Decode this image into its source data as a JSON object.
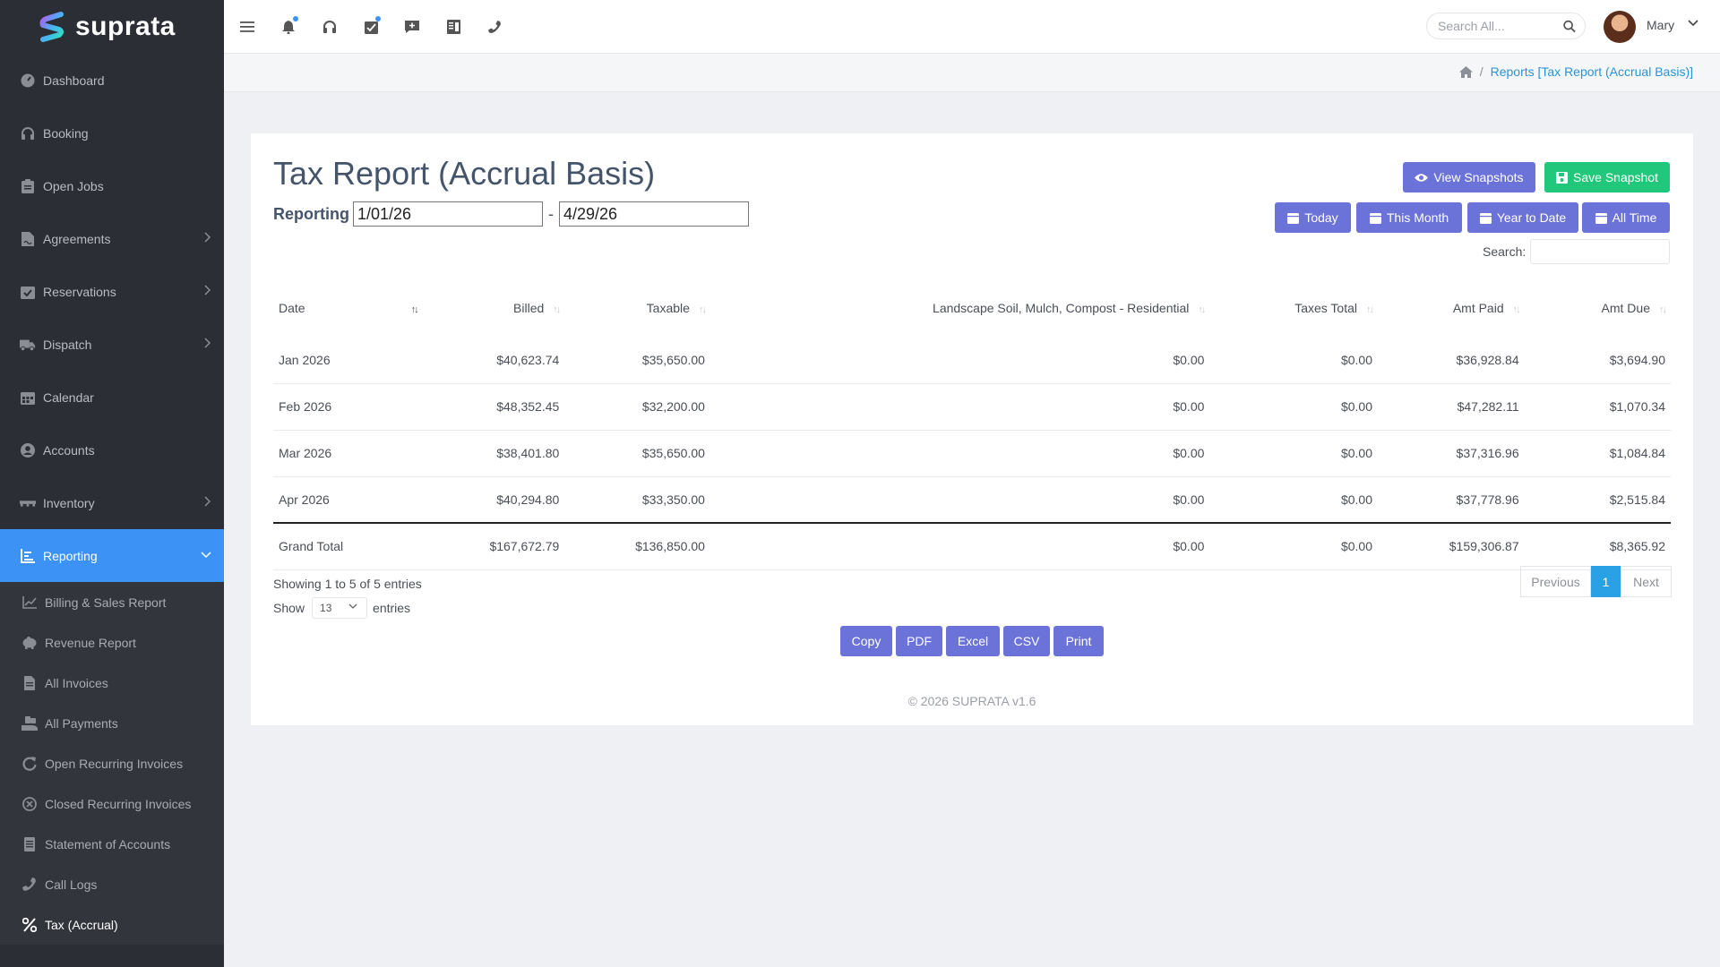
{
  "app": {
    "name": "suprata"
  },
  "sidebar": {
    "items": [
      {
        "label": "Dashboard"
      },
      {
        "label": "Booking"
      },
      {
        "label": "Open Jobs"
      },
      {
        "label": "Agreements"
      },
      {
        "label": "Reservations"
      },
      {
        "label": "Dispatch"
      },
      {
        "label": "Calendar"
      },
      {
        "label": "Accounts"
      },
      {
        "label": "Inventory"
      },
      {
        "label": "Reporting"
      }
    ],
    "reporting_sub": [
      {
        "label": "Billing & Sales Report"
      },
      {
        "label": "Revenue Report"
      },
      {
        "label": "All Invoices"
      },
      {
        "label": "All Payments"
      },
      {
        "label": "Open Recurring Invoices"
      },
      {
        "label": "Closed Recurring Invoices"
      },
      {
        "label": "Statement of Accounts"
      },
      {
        "label": "Call Logs"
      },
      {
        "label": "Tax (Accrual)"
      }
    ]
  },
  "topbar": {
    "search_placeholder": "Search All...",
    "user_name": "Mary"
  },
  "breadcrumb": {
    "current": "Reports [Tax Report (Accrual Basis)]"
  },
  "page": {
    "title": "Tax Report (Accrual Basis)",
    "reporting_label": "Reporting",
    "date_from": "1/01/26",
    "date_to": "4/29/26",
    "date_sep": "-",
    "buttons": {
      "view_snapshots": "View Snapshots",
      "save_snapshot": "Save Snapshot",
      "today": "Today",
      "this_month": "This Month",
      "year_to_date": "Year to Date",
      "all_time": "All Time"
    },
    "search_label": "Search:"
  },
  "table": {
    "columns": [
      "Date",
      "Billed",
      "Taxable",
      "Landscape Soil, Mulch, Compost - Residential",
      "Taxes Total",
      "Amt Paid",
      "Amt Due"
    ],
    "rows": [
      [
        "Jan 2026",
        "$40,623.74",
        "$35,650.00",
        "$0.00",
        "$0.00",
        "$36,928.84",
        "$3,694.90"
      ],
      [
        "Feb 2026",
        "$48,352.45",
        "$32,200.00",
        "$0.00",
        "$0.00",
        "$47,282.11",
        "$1,070.34"
      ],
      [
        "Mar 2026",
        "$38,401.80",
        "$35,650.00",
        "$0.00",
        "$0.00",
        "$37,316.96",
        "$1,084.84"
      ],
      [
        "Apr 2026",
        "$40,294.80",
        "$33,350.00",
        "$0.00",
        "$0.00",
        "$37,778.96",
        "$2,515.84"
      ]
    ],
    "total": [
      "Grand Total",
      "$167,672.79",
      "$136,850.00",
      "$0.00",
      "$0.00",
      "$159,306.87",
      "$8,365.92"
    ]
  },
  "footer_table": {
    "showing": "Showing 1 to 5 of 5 entries",
    "show_label": "Show",
    "page_size": "13",
    "entries_label": "entries",
    "prev": "Previous",
    "page": "1",
    "next": "Next"
  },
  "export": {
    "copy": "Copy",
    "pdf": "PDF",
    "excel": "Excel",
    "csv": "CSV",
    "print": "Print"
  },
  "footer": "© 2026 SUPRATA v1.6",
  "colors": {
    "sidebar_bg": "#2b2e34",
    "active": "#3d93f5",
    "purple": "#6c73d8",
    "green": "#21c77a",
    "link": "#2b93d5"
  }
}
